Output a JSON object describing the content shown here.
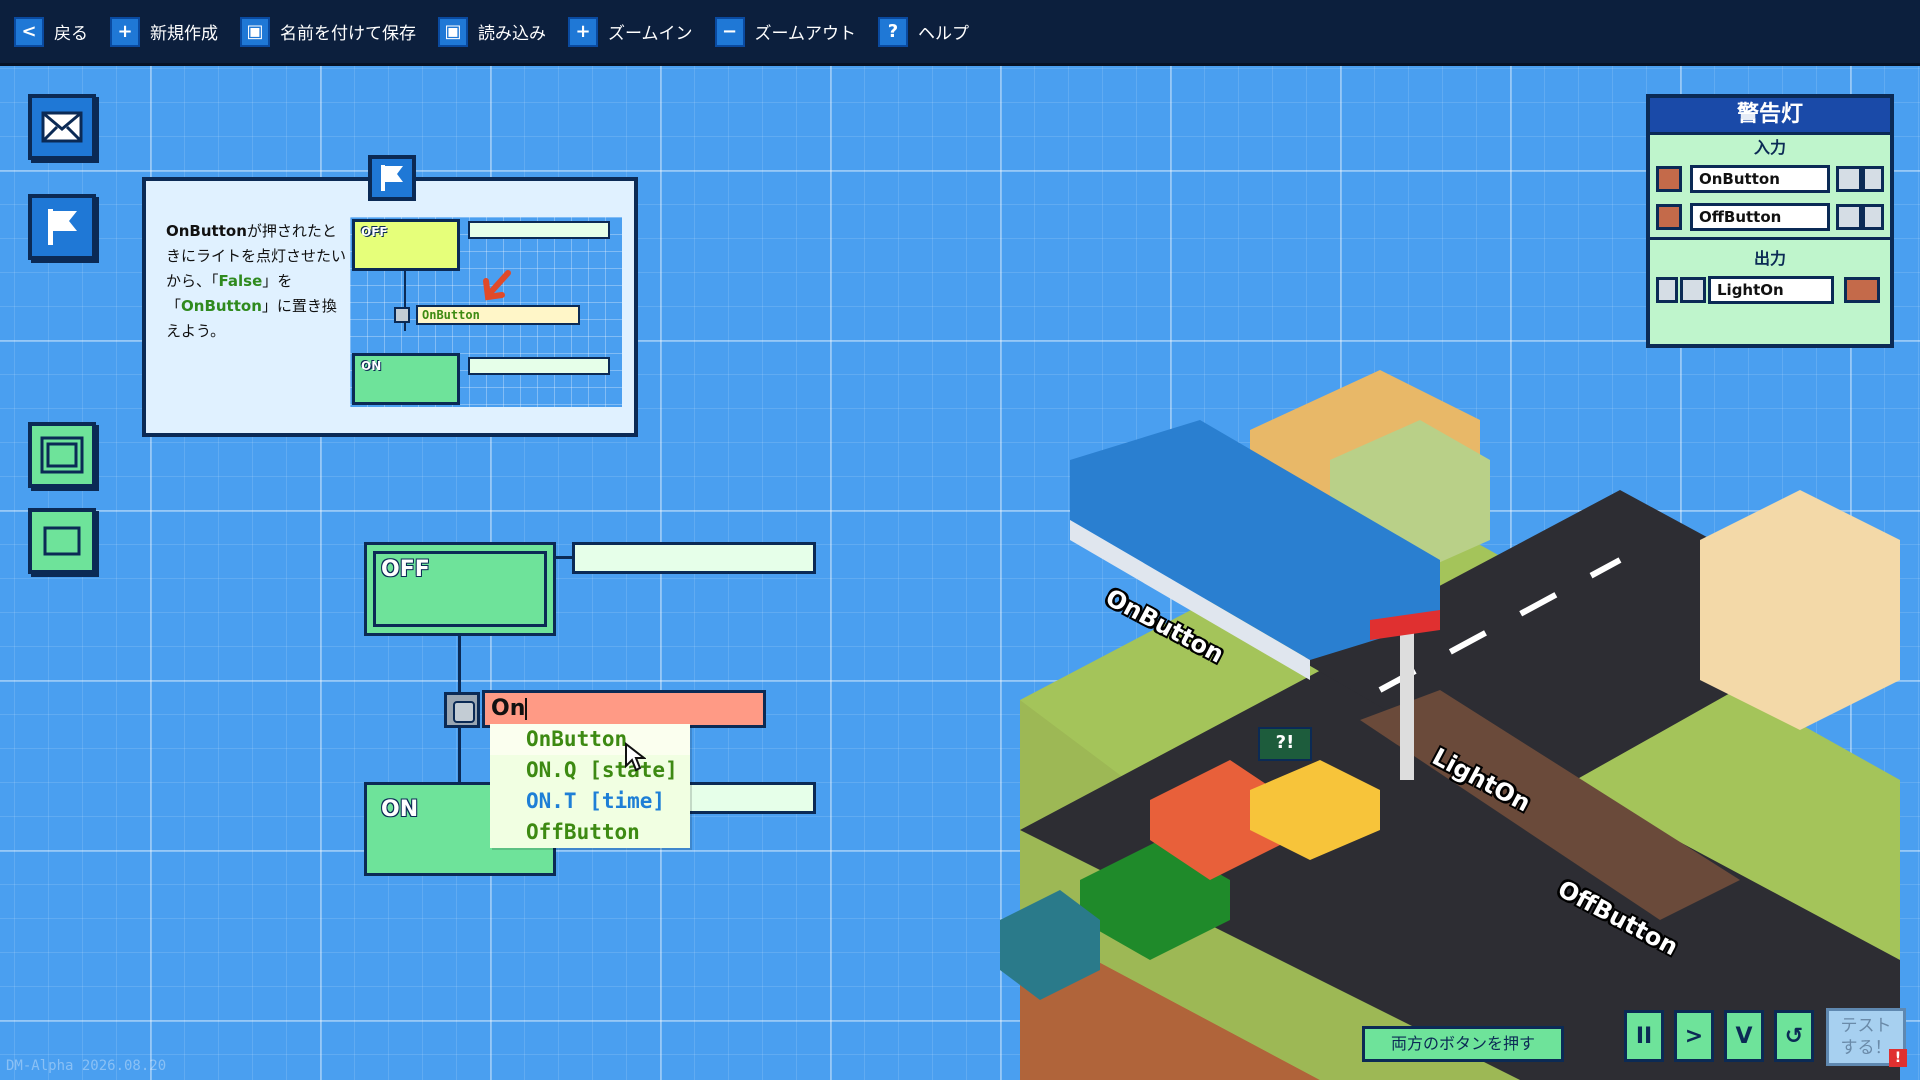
{
  "toolbar": {
    "back": "戻る",
    "new": "新規作成",
    "save_as": "名前を付けて保存",
    "load": "読み込み",
    "zoom_in": "ズームイン",
    "zoom_out": "ズームアウト",
    "help": "ヘルプ"
  },
  "tutorial": {
    "text_parts": [
      "OnButton",
      "が押されたときにライトを点灯させたいから、「",
      "False",
      "」を「",
      "OnButton",
      "」に置き換えよう。"
    ],
    "mini_off": "OFF",
    "mini_on": "ON",
    "mini_condition": "OnButton"
  },
  "ladder": {
    "off_label": "OFF",
    "on_label": "ON",
    "condition_value": "On",
    "autocomplete": [
      {
        "label": "OnButton",
        "color": "#3d8a12"
      },
      {
        "label": "ON.Q [state]",
        "color": "#3d8a12"
      },
      {
        "label": "ON.T [time]",
        "color": "#1e7fd6"
      },
      {
        "label": "OffButton",
        "color": "#3d8a12"
      }
    ]
  },
  "io_panel": {
    "title": "警告灯",
    "input_header": "入力",
    "inputs": [
      "OnButton",
      "OffButton"
    ],
    "output_header": "出力",
    "outputs": [
      "LightOn"
    ]
  },
  "scene": {
    "labels": [
      "OnButton",
      "LightOn",
      "OffButton"
    ],
    "bubble": "?!"
  },
  "controls": {
    "goal": "両方のボタンを押す",
    "pause": "II",
    "step": ">",
    "check": "V",
    "reset": "↺",
    "test": "テスト\nする！"
  },
  "colors": {
    "background": "#4a9ff0",
    "toolbar": "#0c1f3d",
    "step_green": "#6ee39a",
    "condition_red": "#ff9a85"
  },
  "version": "DM-Alpha 2026.08.20"
}
